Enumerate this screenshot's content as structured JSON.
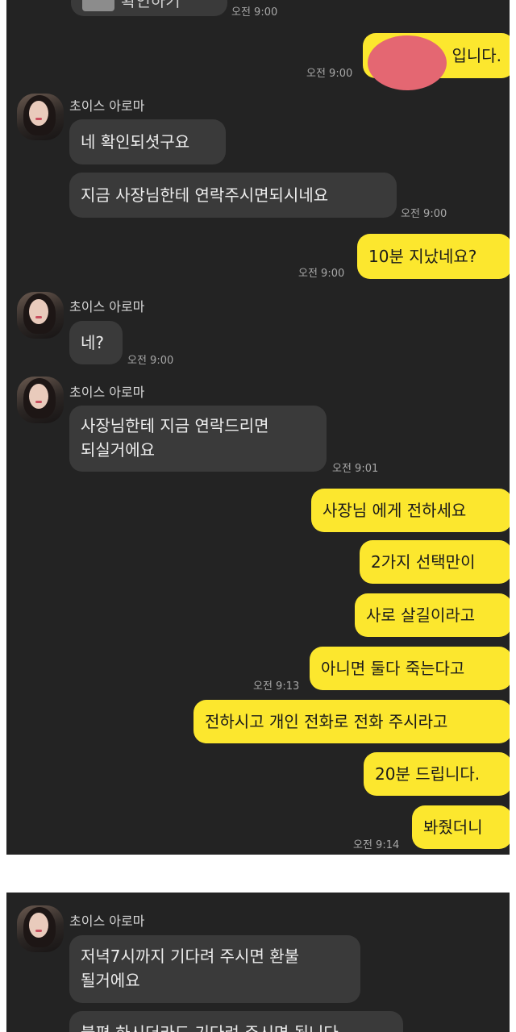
{
  "sender_name": "초이스 아로마",
  "top_partial": {
    "text": "확인하기",
    "time": "오전 9:00"
  },
  "messages": [
    {
      "dir": "out",
      "text": "입니다.",
      "time": "오전 9:00",
      "redacted": true
    },
    {
      "dir": "in",
      "text": "네 확인되셧구요"
    },
    {
      "dir": "in",
      "text": "지금 사장님한테 연락주시면되시네요",
      "time": "오전 9:00"
    },
    {
      "dir": "out",
      "text": "10분 지났네요?",
      "time": "오전 9:00"
    },
    {
      "dir": "in",
      "text": "네?",
      "time": "오전 9:00"
    },
    {
      "dir": "in",
      "lines": [
        "사장님한테 지금 연락드리면",
        "되실거에요"
      ],
      "time": "오전 9:01"
    },
    {
      "dir": "out",
      "text": "사장님 에게 전하세요"
    },
    {
      "dir": "out",
      "text": "2가지 선택만이"
    },
    {
      "dir": "out",
      "text": "사로 살길이라고"
    },
    {
      "dir": "out",
      "text": "아니면 둘다 죽는다고",
      "time": "오전 9:13"
    },
    {
      "dir": "out",
      "text": "전하시고 개인 전화로 전화 주시라고"
    },
    {
      "dir": "out",
      "text": "20분 드립니다."
    },
    {
      "dir": "out",
      "text": "봐줬더니",
      "time": "오전 9:14"
    }
  ],
  "panel2": {
    "sender_name": "초이스 아로마",
    "msg1_lines": [
      "저녁7시까지 기다려 주시면 환불",
      "될거에요"
    ],
    "msg2_partial": "불편 하시더라도 기다려 주시면 됩니다"
  },
  "colors": {
    "background": "#232323",
    "incoming": "#3a3a3a",
    "outgoing": "#fce72e",
    "redaction": "#e46772"
  }
}
